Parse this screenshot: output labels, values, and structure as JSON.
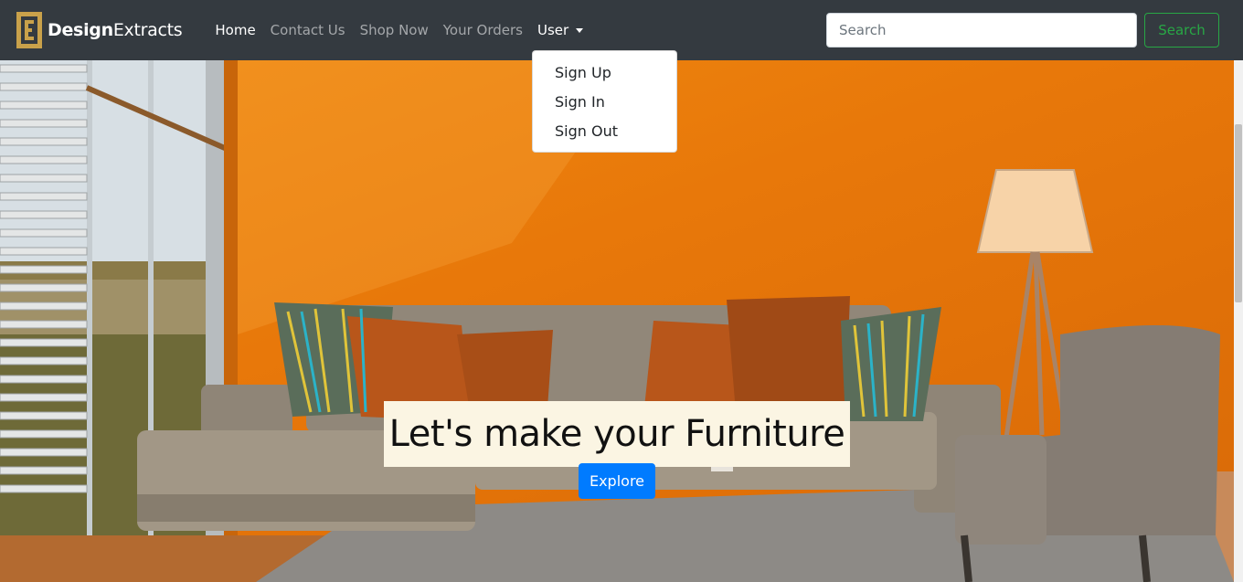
{
  "brand": {
    "name_bold": "Design",
    "name_rest": "Extracts"
  },
  "nav": {
    "items": [
      {
        "label": "Home",
        "active": true
      },
      {
        "label": "Contact Us",
        "active": false
      },
      {
        "label": "Shop Now",
        "active": false
      },
      {
        "label": "Your Orders",
        "active": false
      }
    ],
    "user_label": "User"
  },
  "dropdown": {
    "items": [
      "Sign Up",
      "Sign In",
      "Sign Out"
    ]
  },
  "search": {
    "placeholder": "Search",
    "button_label": "Search"
  },
  "hero": {
    "caption": "Let's make your Furniture",
    "button_label": "Explore"
  },
  "colors": {
    "navbar": "#343a40",
    "search_button": "#28a745",
    "explore_button": "#007bff",
    "wall": "#e77f0c"
  }
}
